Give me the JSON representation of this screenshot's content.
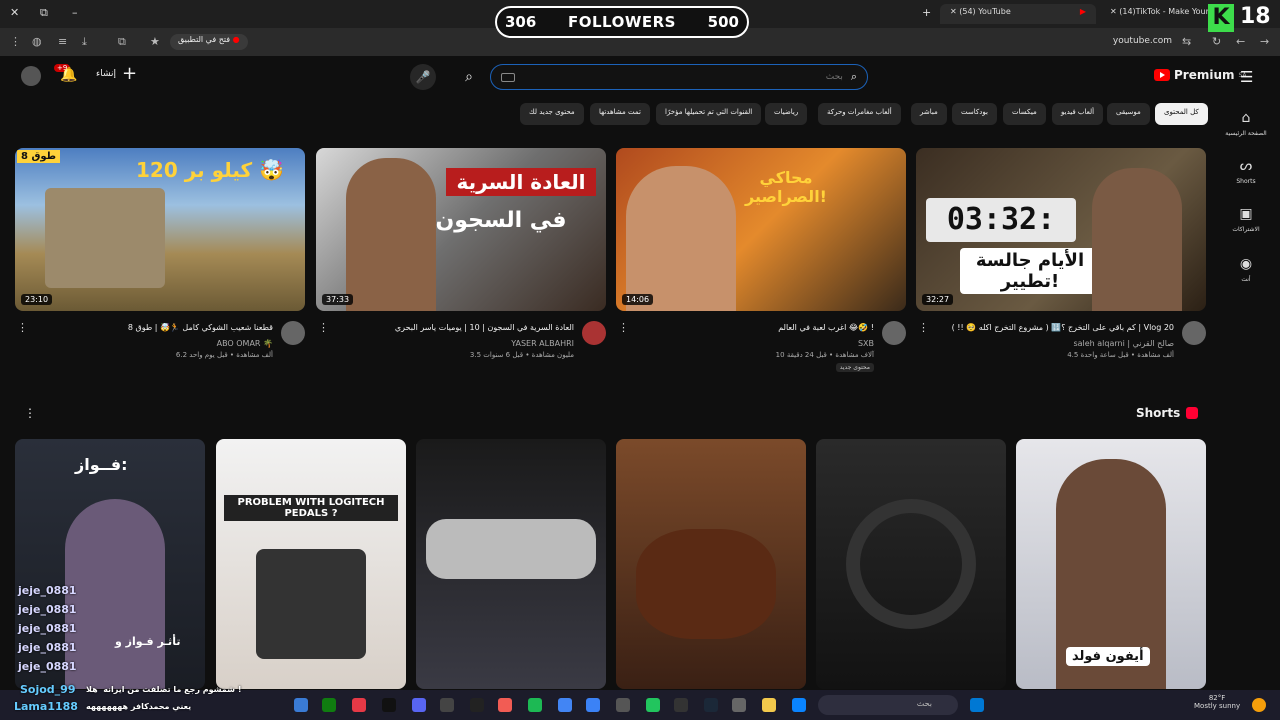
{
  "browser": {
    "tabs": [
      {
        "label": "(54) YouTube"
      },
      {
        "label": "(14)TikTok - Make Your D"
      }
    ],
    "url": "youtube.com",
    "open_in_app": "فتح في التطبيق"
  },
  "overlay": {
    "followers_left": "306",
    "followers_label": "FOLLOWERS",
    "followers_right": "500",
    "logo_k": "K",
    "logo_num": "18"
  },
  "header": {
    "notif_badge": "+9",
    "create_label": "إنشاء",
    "search_placeholder": "بحث",
    "brand": "Premium",
    "brand_region": "SA"
  },
  "chips": [
    "كل المحتوى",
    "موسيقى",
    "ألعاب فيديو",
    "ميكسات",
    "بودكاست",
    "مباشر",
    "ألعاب مغامرات وحركة",
    "رياضيات",
    "القنوات التي تم تحميلها مؤخرًا",
    "تمت مشاهدتها",
    "محتوى جديد لك"
  ],
  "rail": [
    {
      "label": "الصفحة الرئيسية",
      "icon": "home-icon"
    },
    {
      "label": "Shorts",
      "icon": "shorts-icon"
    },
    {
      "label": "الاشتراكات",
      "icon": "subscriptions-icon"
    },
    {
      "label": "أنت",
      "icon": "you-icon"
    }
  ],
  "videos": [
    {
      "duration": "32:27",
      "title": "كم باقي على التخرج ؟🔢 ( مشروع التخرج اكله 🥺 !! ) | Vlog 20",
      "channel": "saleh alqarni | صالح القرني",
      "stats": "4.5 ألف مشاهدة • قبل ساعة واحدة",
      "thumb_text": "الأيام جالسة تطيير!",
      "timer": "03:32:"
    },
    {
      "duration": "14:06",
      "title": "اغرب لعبة في العالم 😂🤣 !",
      "channel": "SXB",
      "stats": "10 آلاف مشاهدة • قبل 24 دقيقة",
      "tag": "محتوى جديد",
      "thumb_text": "محاكي الصراصير!"
    },
    {
      "duration": "37:33",
      "title": "العادة السرية في السجون | 10 | يوميات ياسر البحري",
      "channel": "YASER ALBAHRI",
      "stats": "3.5 مليون مشاهدة • قبل 6 سنوات",
      "thumb_text_1": "العادة السرية",
      "thumb_text_2": "في السجون"
    },
    {
      "duration": "23:10",
      "title": "قطعنا شعيب الشوكي كامل 🏃🤯 | طوق 8",
      "channel": "ABO OMAR 🌴",
      "stats": "6.2 ألف مشاهدة • قبل يوم واحد",
      "thumb_text": "120 كيلو بر 🤯",
      "corner": "طوق 8"
    }
  ],
  "shorts": {
    "heading": "Shorts",
    "items": [
      {
        "caption": "أيفون فولد"
      },
      {
        "caption": ""
      },
      {
        "caption": ""
      },
      {
        "caption": ""
      },
      {
        "caption": "PROBLEM WITH LOGITECH PEDALS ?"
      },
      {
        "caption": "فــواز:",
        "sub": "تأثـر فـواز و"
      }
    ]
  },
  "chat": {
    "names": [
      "jeje_0881",
      "jeje_0881",
      "jeje_0881",
      "jeje_0881",
      "jeje_0881"
    ],
    "user1": "Sojod_99",
    "msg1": "هلا ‎ شمشوم رجع ما تصلفت من ايرانه !",
    "user2": "Lama1188",
    "msg2": "يعني محمدكافر هههههههه"
  },
  "taskbar": {
    "search": "بحث",
    "temp": "82°F",
    "weather": "Mostly sunny"
  }
}
